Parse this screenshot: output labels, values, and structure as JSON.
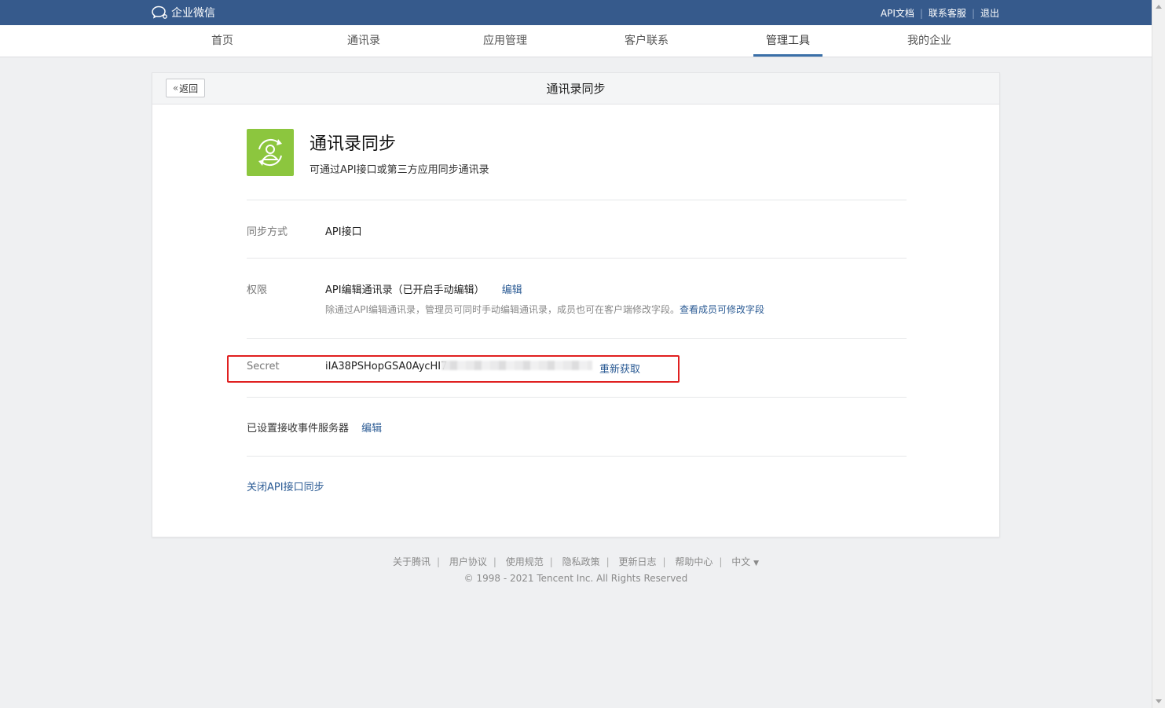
{
  "brand": {
    "name": "企业微信"
  },
  "toplinks": {
    "api_doc": "API文档",
    "support": "联系客服",
    "logout": "退出",
    "sep": "|"
  },
  "nav": {
    "tabs": [
      {
        "label": "首页"
      },
      {
        "label": "通讯录"
      },
      {
        "label": "应用管理"
      },
      {
        "label": "客户联系"
      },
      {
        "label": "管理工具",
        "active": true
      },
      {
        "label": "我的企业"
      }
    ]
  },
  "card": {
    "back_label": "返回",
    "title": "通讯录同步",
    "app_name": "通讯录同步",
    "app_desc": "可通过API接口或第三方应用同步通讯录",
    "icon_color": "#8cc63e",
    "sync_mode": {
      "label": "同步方式",
      "value": "API接口"
    },
    "permission": {
      "label": "权限",
      "value": "API编辑通讯录（已开启手动编辑）",
      "edit": "编辑",
      "hint": "除通过API编辑通讯录，管理员可同时手动编辑通讯录，成员也可在客户端修改字段。",
      "hint_link": "查看成员可修改字段"
    },
    "secret": {
      "label": "Secret",
      "value": "iIA38PSHopGSA0AycHI7",
      "refresh": "重新获取"
    },
    "event_server": {
      "label": "已设置接收事件服务器",
      "edit": "编辑"
    },
    "close_link": "关闭API接口同步"
  },
  "footer": {
    "links": [
      "关于腾讯",
      "用户协议",
      "使用规范",
      "隐私政策",
      "更新日志",
      "帮助中心"
    ],
    "language": "中文",
    "copyright": "© 1998 - 2021 Tencent Inc. All Rights Reserved"
  },
  "colors": {
    "topbar": "#365a8c",
    "link": "#2b5b94",
    "highlight_box": "#e02020"
  }
}
